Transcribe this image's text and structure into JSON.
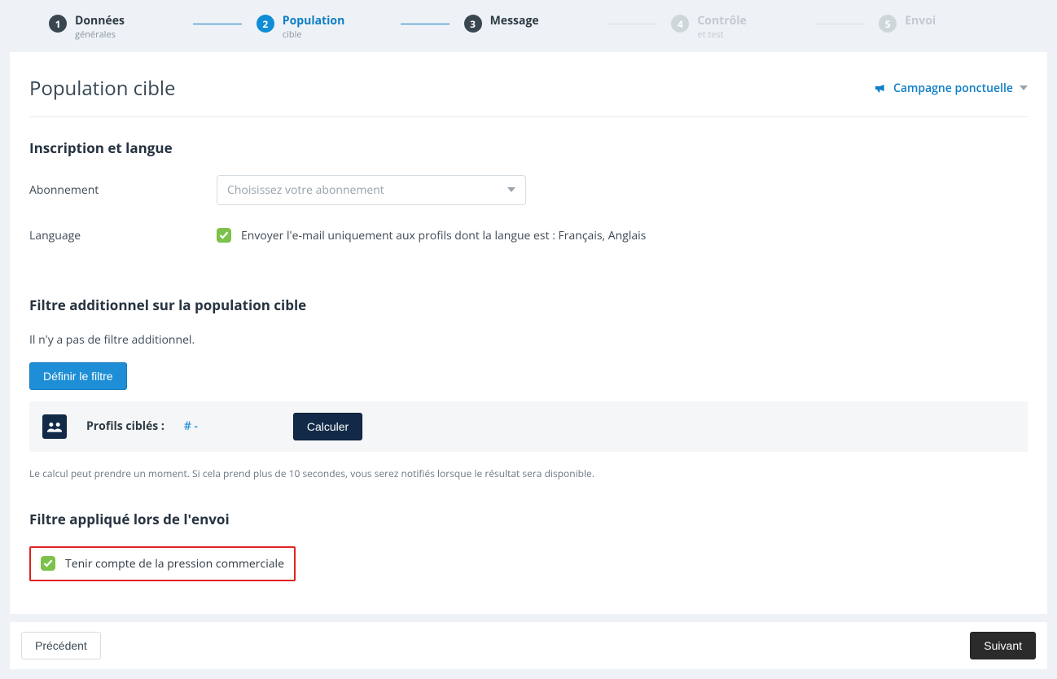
{
  "wizard": {
    "steps": [
      {
        "num": "1",
        "label": "Données",
        "sub": "générales"
      },
      {
        "num": "2",
        "label": "Population",
        "sub": "cible"
      },
      {
        "num": "3",
        "label": "Message",
        "sub": ""
      },
      {
        "num": "4",
        "label": "Contrôle",
        "sub": "et test"
      },
      {
        "num": "5",
        "label": "Envoi",
        "sub": ""
      }
    ]
  },
  "page": {
    "title": "Population cible",
    "campaign_type": "Campagne ponctuelle"
  },
  "section_inscription": {
    "heading": "Inscription et langue",
    "abonnement_label": "Abonnement",
    "abonnement_placeholder": "Choisissez votre abonnement",
    "language_label": "Language",
    "language_checkbox_text": "Envoyer l'e-mail uniquement aux profils dont la langue est : Français, Anglais",
    "language_checked": true
  },
  "section_filter": {
    "heading": "Filtre additionnel sur la population cible",
    "no_filter_text": "Il n'y a pas de filtre additionnel.",
    "define_btn": "Définir le filtre",
    "profile_label": "Profils ciblés :",
    "profile_value": "# -",
    "calc_btn": "Calculer",
    "note": "Le calcul peut prendre un moment. Si cela prend plus de 10 secondes, vous serez notifiés lorsque le résultat sera disponible."
  },
  "section_send_filter": {
    "heading": "Filtre appliqué lors de l'envoi",
    "pressure_label": "Tenir compte de la pression commerciale",
    "pressure_checked": true
  },
  "footer": {
    "prev": "Précédent",
    "next": "Suivant"
  }
}
